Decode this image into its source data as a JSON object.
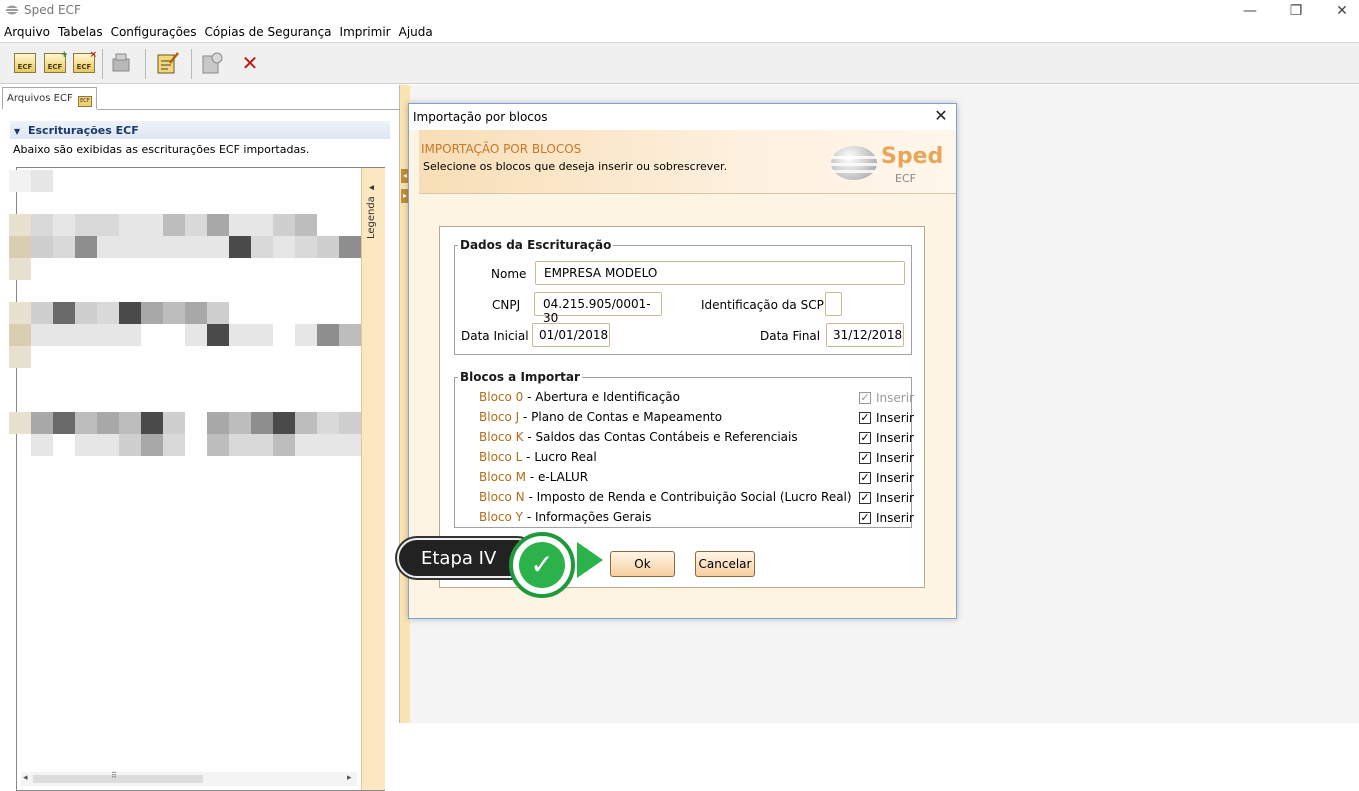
{
  "window": {
    "title": "Sped ECF",
    "minimize": "—",
    "maximize": "❐",
    "close": "✕"
  },
  "menu": [
    "Arquivo",
    "Tabelas",
    "Configurações",
    "Cópias de Segurança",
    "Imprimir",
    "Ajuda"
  ],
  "toolbar": {
    "icon_text": "ECF",
    "add_badge": "+",
    "remove_badge": "×",
    "delete_glyph": "✕"
  },
  "left_panel": {
    "tab_label": "Arquivos ECF",
    "tab_icon_text": "ECF",
    "section_title": "Escriturações ECF",
    "section_desc": "Abaixo são exibidas as escriturações ECF importadas.",
    "legend_label": "Legenda ▸",
    "scroll_left": "◂",
    "scroll_right": "▸",
    "scroll_grip": "⠿"
  },
  "dialog": {
    "title": "Importação por blocos",
    "close_glyph": "✕",
    "header_title": "IMPORTAÇÃO POR BLOCOS",
    "header_subtitle": "Selecione os blocos que deseja inserir ou sobrescrever.",
    "logo_word": "Sped",
    "logo_sub": "ECF",
    "dados": {
      "legend": "Dados da Escrituração",
      "nome_label": "Nome",
      "nome_value": "EMPRESA MODELO",
      "cnpj_label": "CNPJ",
      "cnpj_value": "04.215.905/0001-30",
      "scp_label": "Identificação da SCP",
      "scp_value": "",
      "data_inicial_label": "Data Inicial",
      "data_inicial_value": "01/01/2018",
      "data_final_label": "Data Final",
      "data_final_value": "31/12/2018"
    },
    "blocos": {
      "legend": "Blocos a Importar",
      "check_mark": "✓",
      "items": [
        {
          "code": "Bloco 0",
          "desc": " - Abertura e Identificação",
          "check_label": "Inserir"
        },
        {
          "code": "Bloco J",
          "desc": " - Plano de Contas e Mapeamento",
          "check_label": "Inserir"
        },
        {
          "code": "Bloco K",
          "desc": " - Saldos das Contas Contábeis e Referenciais",
          "check_label": "Inserir"
        },
        {
          "code": "Bloco L",
          "desc": " - Lucro Real",
          "check_label": "Inserir"
        },
        {
          "code": "Bloco M",
          "desc": " - e-LALUR",
          "check_label": "Inserir"
        },
        {
          "code": "Bloco N",
          "desc": " - Imposto de Renda e Contribuição Social (Lucro Real)",
          "check_label": "Inserir"
        },
        {
          "code": "Bloco Y",
          "desc": " - Informações Gerais",
          "check_label": "Inserir"
        }
      ]
    },
    "ok_label": "Ok",
    "cancel_label": "Cancelar"
  },
  "callout": {
    "label": "Etapa IV",
    "check_glyph": "✓"
  },
  "colors": {
    "accent_orange": "#c8762a",
    "bloco_code": "#b06d1a",
    "callout_green": "#2cb24a"
  }
}
